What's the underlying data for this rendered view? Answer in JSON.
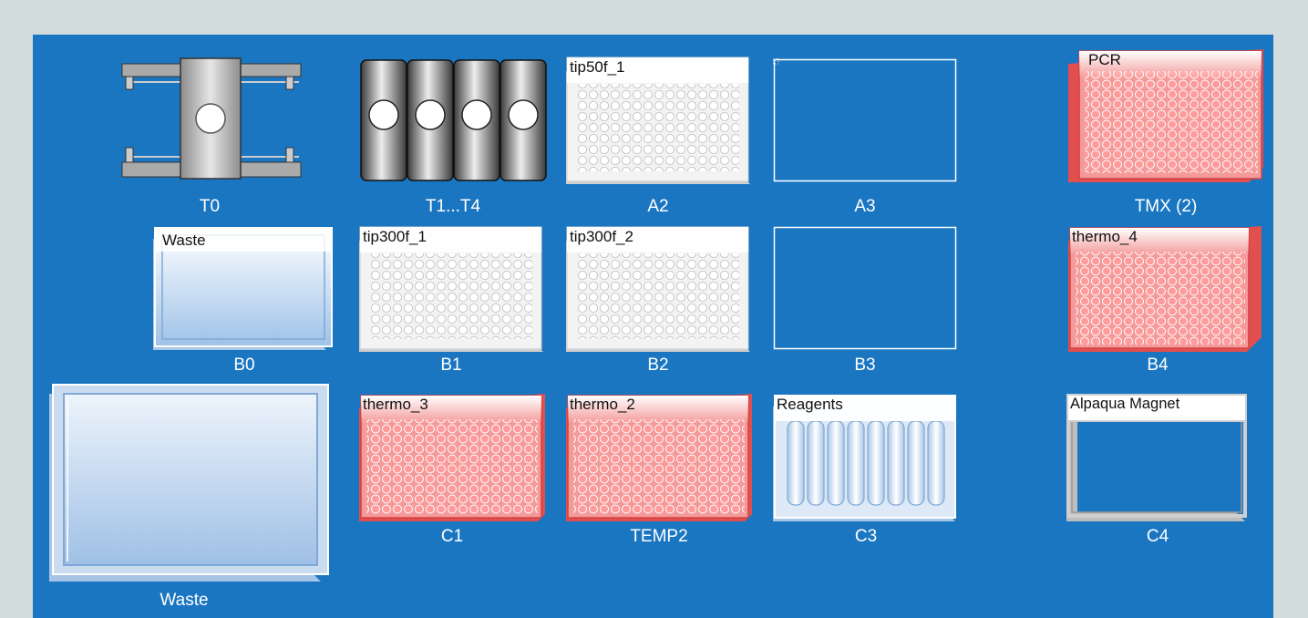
{
  "deck": {
    "slots": [
      {
        "id": "T0",
        "label": "T0"
      },
      {
        "id": "T1T4",
        "label": "T1...T4"
      },
      {
        "id": "A2",
        "label": "A2",
        "labware": "tip50f_1"
      },
      {
        "id": "A3",
        "label": "A3"
      },
      {
        "id": "TMX",
        "label": "TMX (2)",
        "labware": "PCR"
      },
      {
        "id": "B0",
        "label": "B0",
        "labware": "Waste"
      },
      {
        "id": "B1",
        "label": "B1",
        "labware": "tip300f_1"
      },
      {
        "id": "B2",
        "label": "B2",
        "labware": "tip300f_2"
      },
      {
        "id": "B3",
        "label": "B3"
      },
      {
        "id": "B4",
        "label": "B4",
        "labware": "thermo_4"
      },
      {
        "id": "Waste",
        "label": "Waste"
      },
      {
        "id": "C1",
        "label": "C1",
        "labware": "thermo_3"
      },
      {
        "id": "TEMP2",
        "label": "TEMP2",
        "labware": "thermo_2"
      },
      {
        "id": "C3",
        "label": "C3",
        "labware": "Reagents"
      },
      {
        "id": "C4",
        "label": "C4",
        "labware": "Alpaqua Magnet"
      }
    ]
  },
  "colors": {
    "deck_background": "#1b76c2",
    "page_background": "#d3dcdc",
    "thermo_plate": "#f27d7d",
    "tip_rack": "#f5f5f5",
    "reservoir": "#cfe0f3"
  },
  "icons": [
    "tube-rack-icon",
    "thermo-block-icon",
    "tip-rack-icon",
    "pcr-plate-icon",
    "reservoir-icon",
    "magnet-plate-icon",
    "trough-icon"
  ]
}
